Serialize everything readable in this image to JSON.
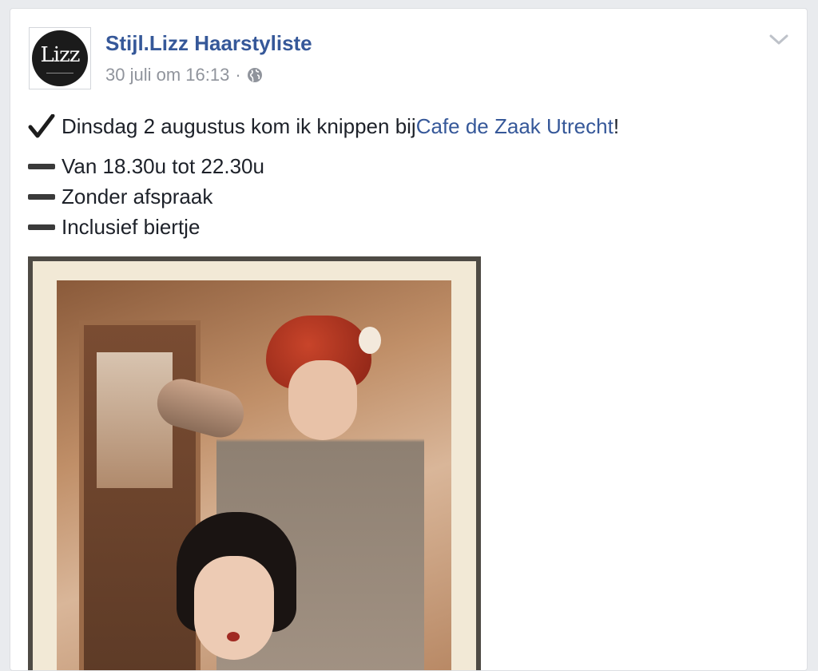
{
  "post": {
    "page_name": "Stijl.Lizz Haarstyliste",
    "timestamp": "30 juli om 16:13",
    "separator": "·",
    "avatar_text": "Lizz",
    "line1_before": "Dinsdag 2 augustus kom ik knippen bij ",
    "line1_link": "Cafe de Zaak Utrecht",
    "line1_after": "!",
    "items": [
      "Van 18.30u tot 22.30u",
      "Zonder afspraak",
      "Inclusief biertje"
    ]
  },
  "icons": {
    "privacy": "globe-icon",
    "menu": "chevron-down-icon",
    "check": "check-mark-icon",
    "dash": "heavy-minus-icon"
  },
  "colors": {
    "link": "#365899",
    "meta": "#90949c",
    "text": "#1d2129",
    "background": "#e9ebee"
  }
}
